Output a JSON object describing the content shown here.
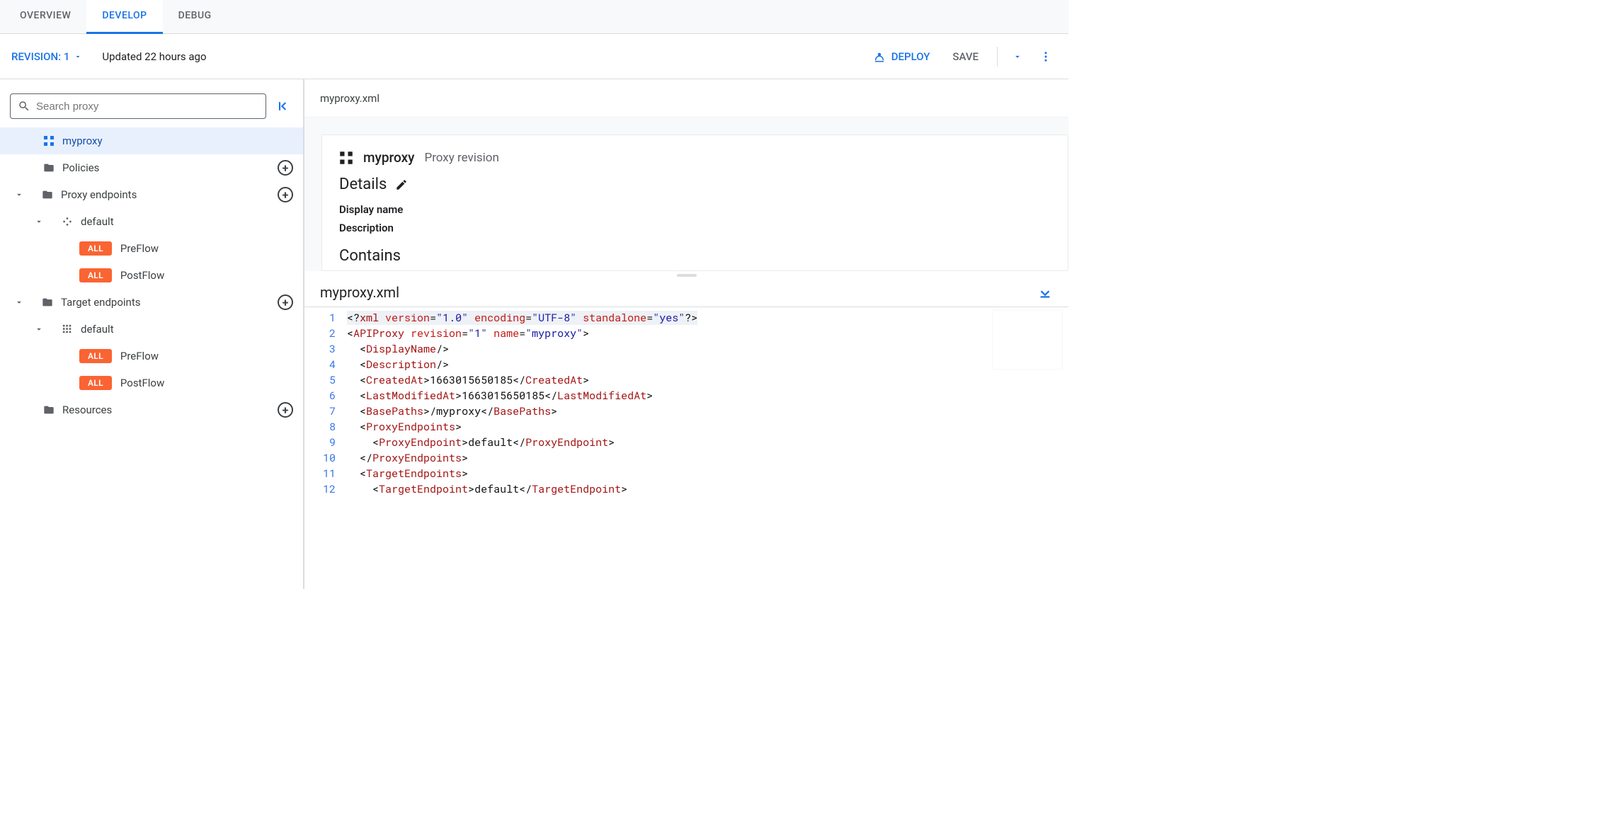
{
  "tabs": {
    "overview": "OVERVIEW",
    "develop": "DEVELOP",
    "debug": "DEBUG"
  },
  "toolbar": {
    "revision_label": "REVISION: 1",
    "updated": "Updated 22 hours ago",
    "deploy": "DEPLOY",
    "save": "SAVE"
  },
  "sidebar": {
    "search_placeholder": "Search proxy",
    "items": [
      {
        "label": "myproxy"
      },
      {
        "label": "Policies"
      },
      {
        "label": "Proxy endpoints"
      },
      {
        "label": "default"
      },
      {
        "badge": "ALL",
        "label": "PreFlow"
      },
      {
        "badge": "ALL",
        "label": "PostFlow"
      },
      {
        "label": "Target endpoints"
      },
      {
        "label": "default"
      },
      {
        "badge": "ALL",
        "label": "PreFlow"
      },
      {
        "badge": "ALL",
        "label": "PostFlow"
      },
      {
        "label": "Resources"
      }
    ]
  },
  "breadcrumb": "myproxy.xml",
  "card": {
    "title": "myproxy",
    "subtitle": "Proxy revision",
    "details_heading": "Details",
    "row1": "Display name",
    "row2": "Description",
    "contains_heading": "Contains"
  },
  "editor": {
    "tab_title": "myproxy.xml",
    "data": {
      "revision": "1",
      "name": "myproxy",
      "createdAt": "1663015650185",
      "lastModifiedAt": "1663015650185",
      "basePath": "/myproxy",
      "proxyEndpoint": "default",
      "targetEndpoint": "default"
    },
    "line_numbers": [
      "1",
      "2",
      "3",
      "4",
      "5",
      "6",
      "7",
      "8",
      "9",
      "10",
      "11",
      "12"
    ]
  }
}
